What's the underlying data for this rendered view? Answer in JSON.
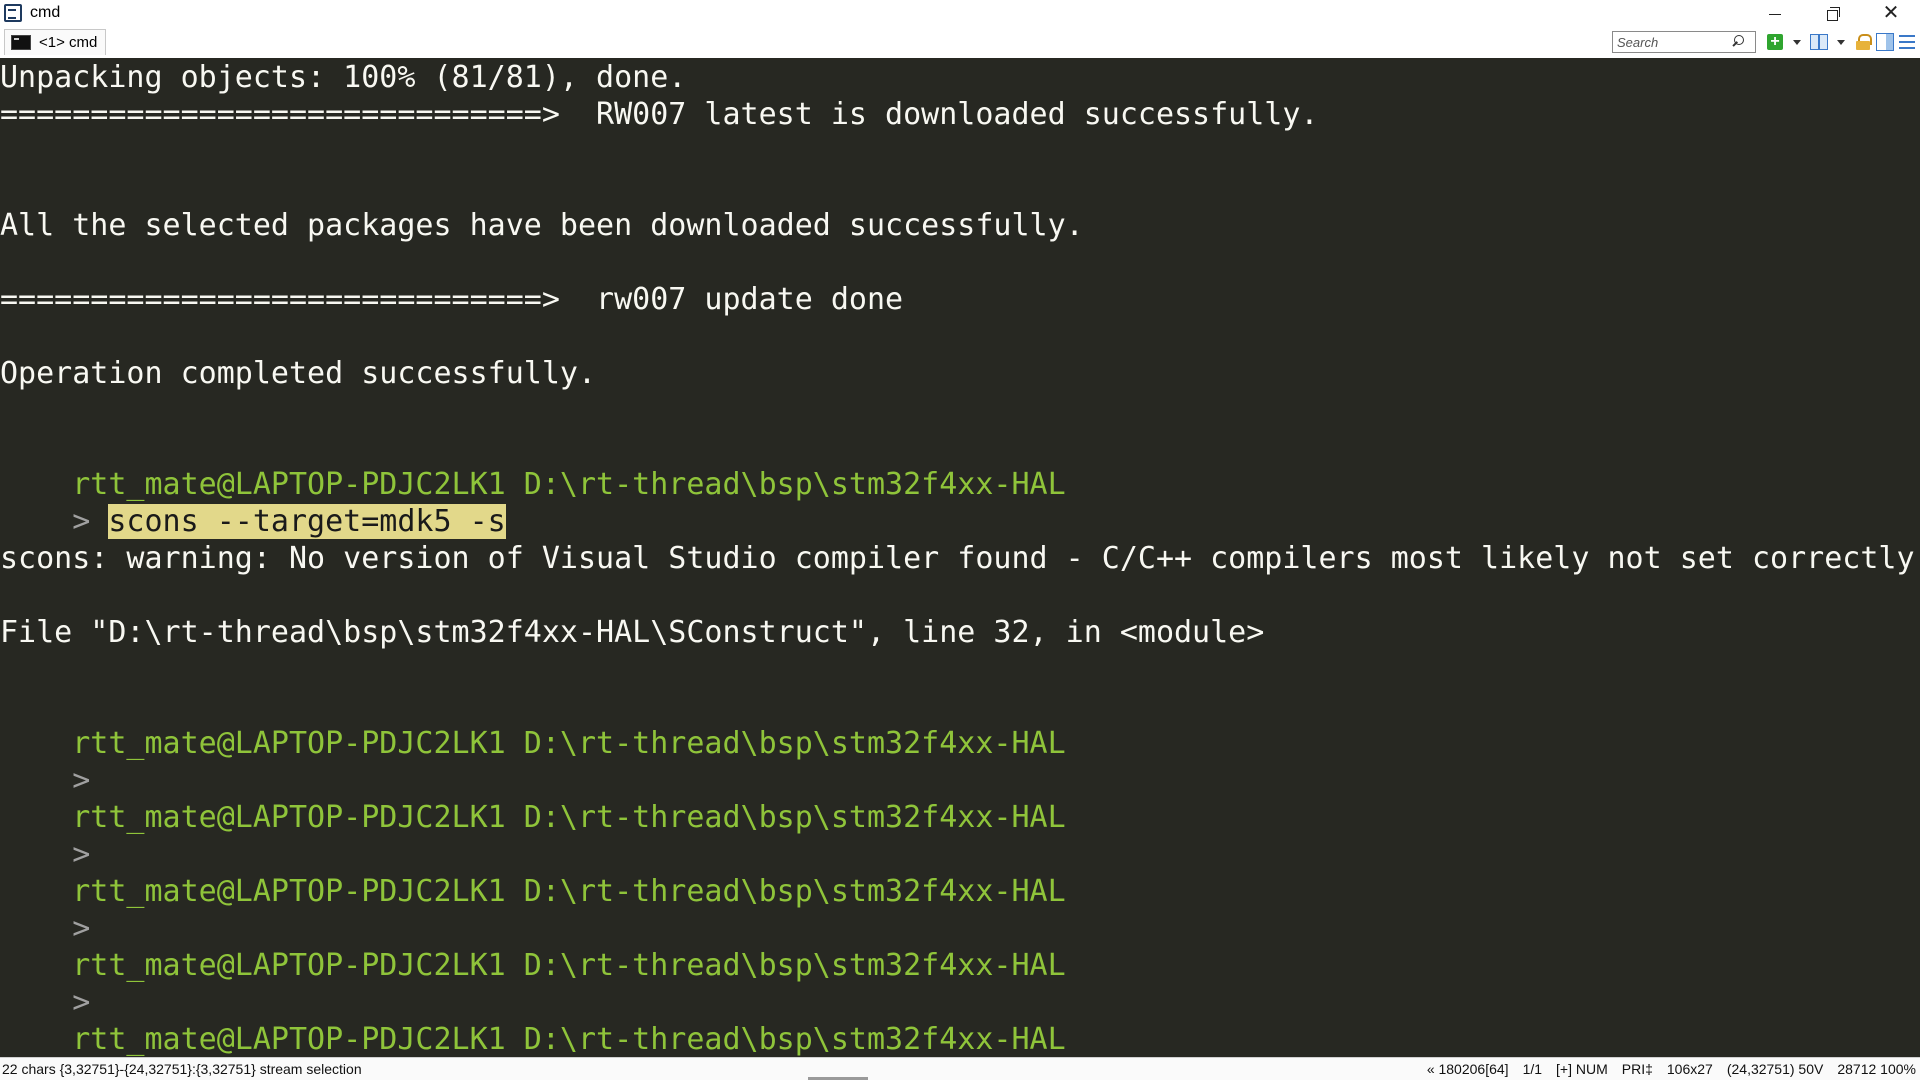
{
  "window": {
    "title": "cmd"
  },
  "tab": {
    "label": "<1> cmd"
  },
  "search": {
    "placeholder": "Search"
  },
  "console": {
    "line1": "Unpacking objects: 100% (81/81), done.",
    "line2": "==============================>  RW007 latest is downloaded successfully.",
    "line3": "All the selected packages have been downloaded successfully.",
    "line4": "==============================>  rw007 update done",
    "line5": "Operation completed successfully.",
    "prompt_user": "rtt_mate@LAPTOP-PDJC2LK1",
    "prompt_path": "D:\\rt-thread\\bsp\\stm32f4xx-HAL",
    "caret": ">",
    "command": "scons --target=mdk5 -s",
    "warning": "scons: warning: No version of Visual Studio compiler found - C/C++ compilers most likely not set correctly",
    "file_line": "File \"D:\\rt-thread\\bsp\\stm32f4xx-HAL\\SConstruct\", line 32, in <module>"
  },
  "status": {
    "selection": "22 chars {3,32751}-{24,32751}:{3,32751} stream selection",
    "encoding": "« 180206[64]",
    "tab_pos": "1/1",
    "modes": "[+] NUM",
    "priority": "PRI‡",
    "size": "106x27",
    "cursor": "(24,32751) 50V",
    "pid_zoom": "28712 100%"
  },
  "colors": {
    "console_bg": "#272822",
    "console_fg": "#f8f8f2",
    "prompt_green": "#8fc43a",
    "selection_bg": "#e2d88a"
  }
}
